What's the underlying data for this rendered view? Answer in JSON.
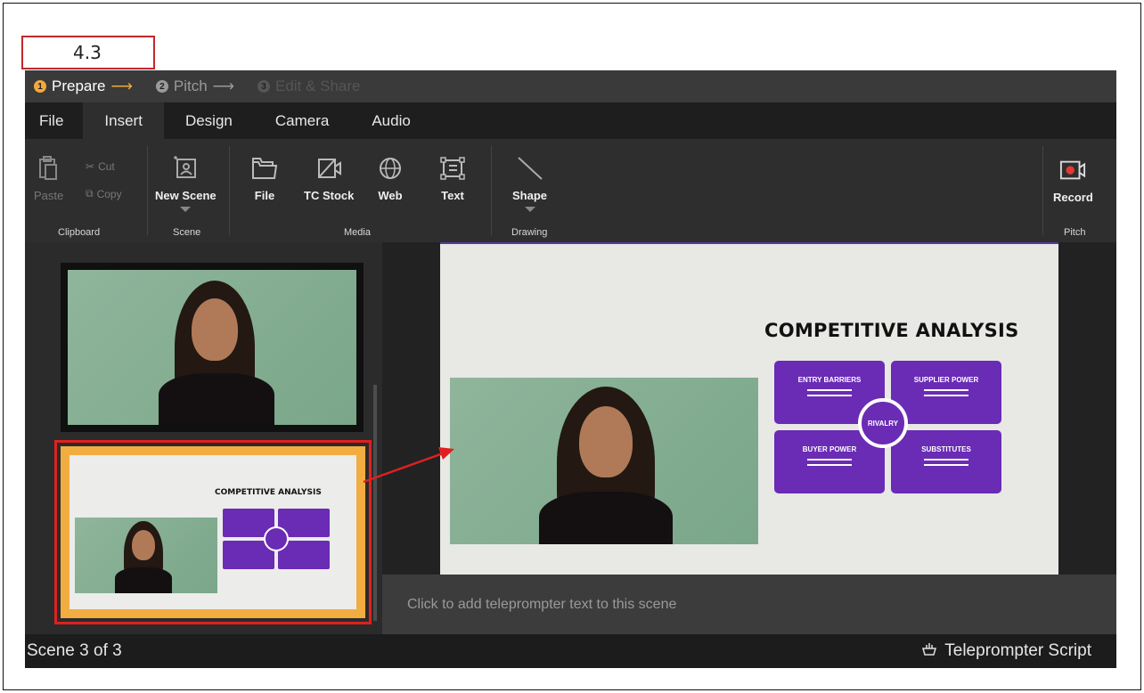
{
  "step_label": "4.3",
  "steps": [
    {
      "num": "1",
      "label": "Prepare",
      "arrow": "⟶"
    },
    {
      "num": "2",
      "label": "Pitch",
      "arrow": "⟶"
    },
    {
      "num": "3",
      "label": "Edit & Share"
    }
  ],
  "menu": [
    "File",
    "Insert",
    "Design",
    "Camera",
    "Audio"
  ],
  "ribbon": {
    "paste": "Paste",
    "cut": "Cut",
    "copy": "Copy",
    "clipboard_group": "Clipboard",
    "new_scene": "New Scene",
    "scene_group": "Scene",
    "file": "File",
    "tc_stock": "TC Stock",
    "web": "Web",
    "text": "Text",
    "media_group": "Media",
    "shape": "Shape",
    "drawing_group": "Drawing",
    "record": "Record",
    "pitch_group": "Pitch"
  },
  "slide": {
    "title": "COMPETITIVE ANALYSIS",
    "boxes": [
      "ENTRY BARRIERS",
      "SUPPLIER POWER",
      "BUYER POWER",
      "SUBSTITUTES"
    ],
    "center": "RIVALRY"
  },
  "teleprompter_placeholder": "Click to add teleprompter text to this scene",
  "status": {
    "scene": "Scene 3 of 3",
    "teleprompter_script": "Teleprompter Script"
  },
  "colors": {
    "accent": "#f2a93b",
    "purple": "#6a2bb5",
    "annotation_red": "#e02020"
  }
}
